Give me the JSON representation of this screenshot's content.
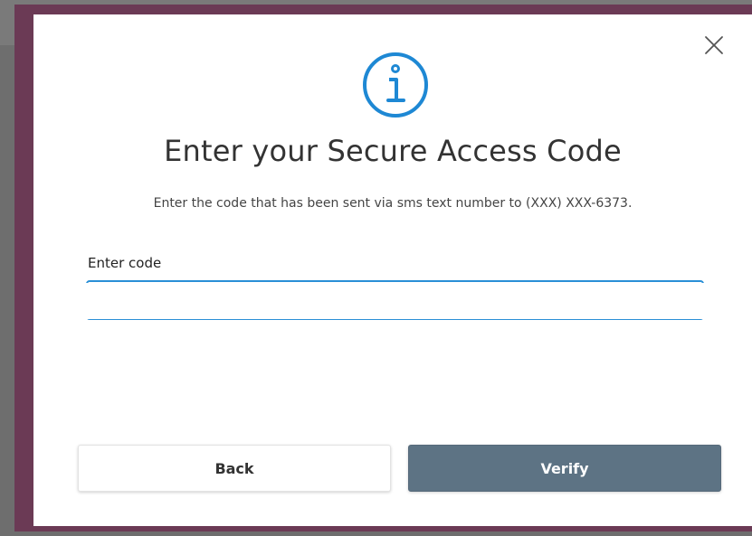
{
  "dialog": {
    "title": "Enter your Secure Access Code",
    "subtitle": "Enter the code that has been sent via sms text number to (XXX) XXX-6373.",
    "field_label": "Enter code",
    "input_value": "",
    "input_placeholder": "",
    "back_label": "Back",
    "verify_label": "Verify",
    "icons": {
      "info": "info-icon",
      "close": "close-icon"
    }
  },
  "colors": {
    "accent": "#1e88d4",
    "frame": "#6b3a55",
    "verify_bg": "#5d7384",
    "input_border": "#2a8fd6"
  }
}
